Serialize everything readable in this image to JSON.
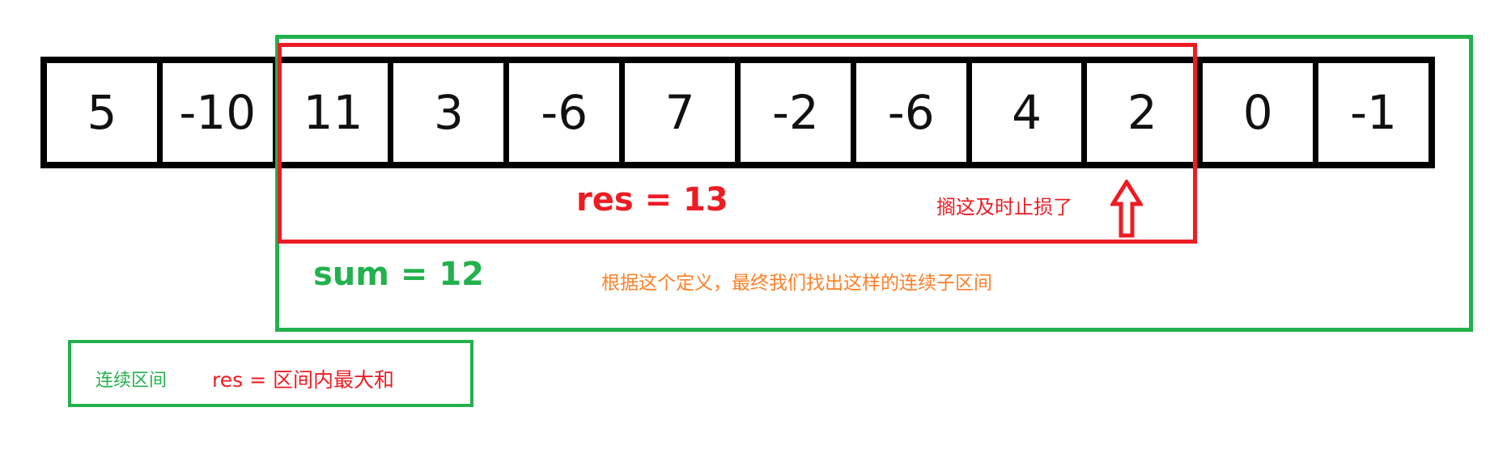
{
  "array": {
    "cells": [
      "5",
      "-10",
      "11",
      "3",
      "-6",
      "7",
      "-2",
      "-6",
      "4",
      "2",
      "0",
      "-1"
    ]
  },
  "annotations": {
    "res_label": "res = 13",
    "stop_note": "搁这及时止损了",
    "sum_label": "sum = 12",
    "definition_note": "根据这个定义，最终我们找出这样的连续子区间"
  },
  "legend": {
    "green_text": "连续区间",
    "red_text": "res = 区间内最大和"
  },
  "colors": {
    "green": "#22b14c",
    "red": "#ed1c24",
    "orange": "#ff7f27",
    "black": "#000000"
  },
  "icons": {
    "pointer": "up-arrow-icon"
  }
}
